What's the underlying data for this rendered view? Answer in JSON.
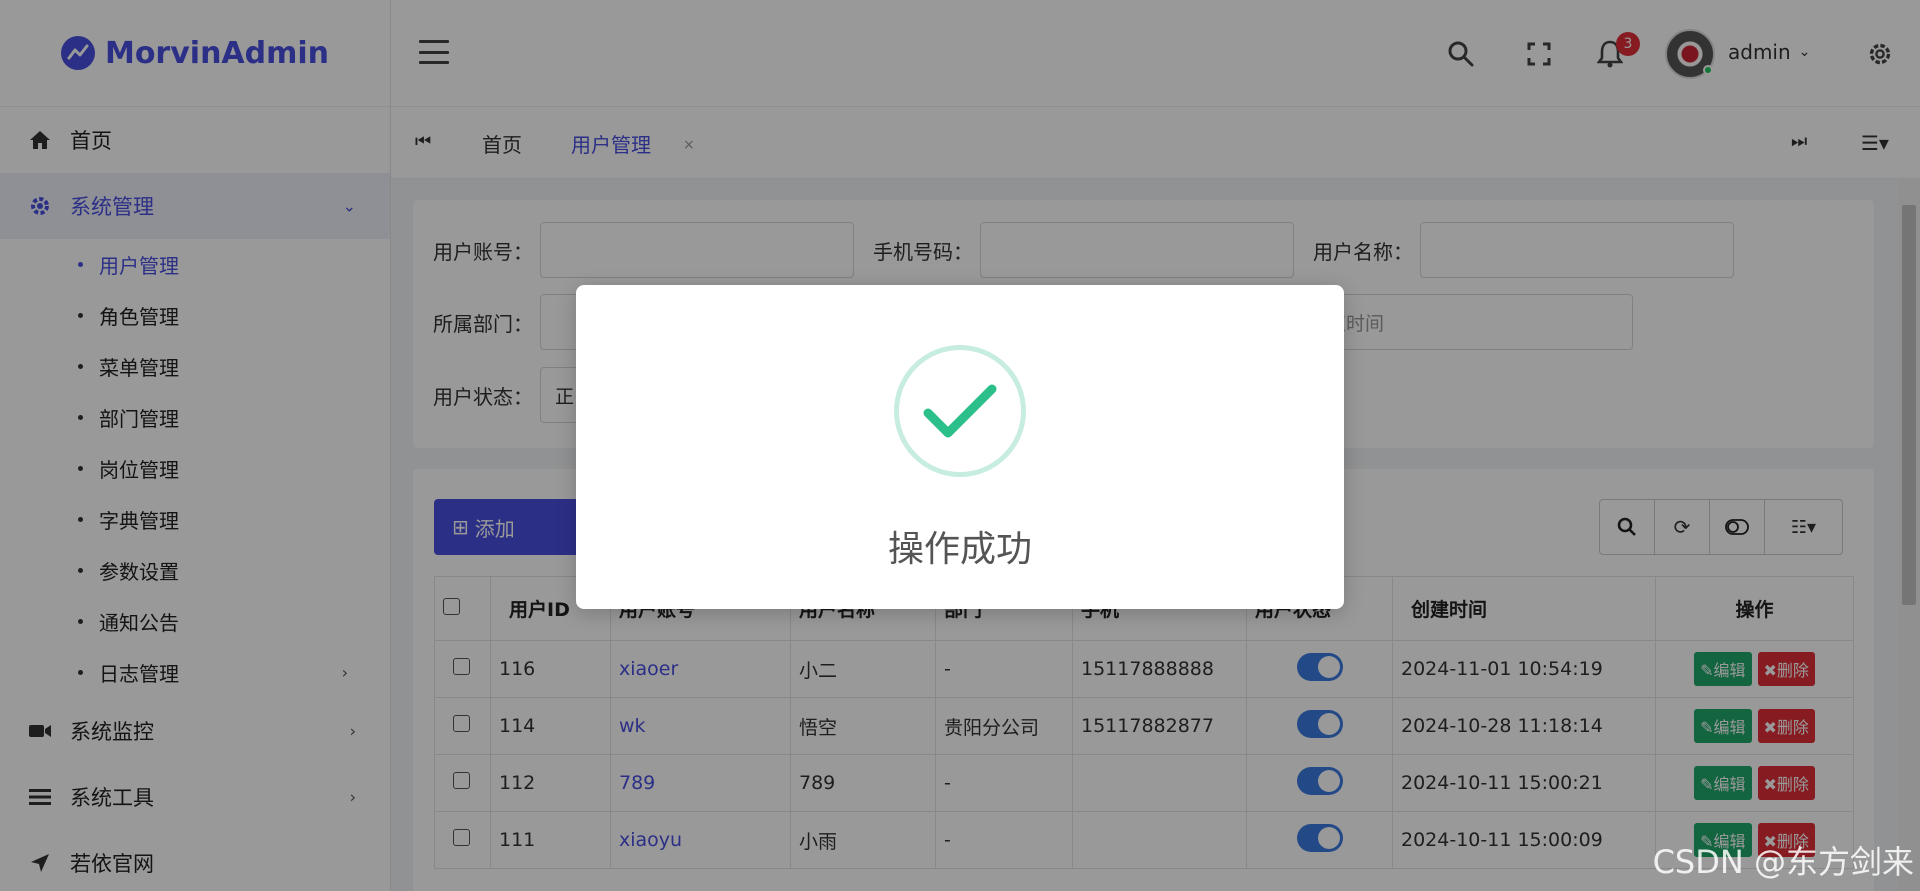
{
  "app": {
    "title": "MorvinAdmin"
  },
  "sidebar": {
    "items": [
      {
        "label": "首页",
        "icon": "home-icon"
      },
      {
        "label": "系统管理",
        "icon": "gear-icon",
        "expanded": true
      },
      {
        "label": "系统监控",
        "icon": "video-icon"
      },
      {
        "label": "系统工具",
        "icon": "list-icon"
      },
      {
        "label": "若依官网",
        "icon": "location-arrow-icon"
      }
    ],
    "sub_items": [
      {
        "label": "用户管理",
        "active": true
      },
      {
        "label": "角色管理"
      },
      {
        "label": "菜单管理"
      },
      {
        "label": "部门管理"
      },
      {
        "label": "岗位管理"
      },
      {
        "label": "字典管理"
      },
      {
        "label": "参数设置"
      },
      {
        "label": "通知公告"
      },
      {
        "label": "日志管理"
      }
    ]
  },
  "header": {
    "notification_count": "3",
    "user_name": "admin"
  },
  "tabs": {
    "items": [
      {
        "label": "首页"
      },
      {
        "label": "用户管理",
        "active": true
      }
    ],
    "close_label": "×"
  },
  "search": {
    "fields": [
      {
        "label": "用户账号：",
        "value": ""
      },
      {
        "label": "手机号码：",
        "value": ""
      },
      {
        "label": "用户名称：",
        "value": ""
      },
      {
        "label": "所属部门：",
        "value": ""
      },
      {
        "label": "用户状态：",
        "value": "正"
      }
    ],
    "end_time_placeholder": "结束时间"
  },
  "toolbar": {
    "add_label": "添加"
  },
  "table": {
    "headers": [
      "用户ID",
      "用户账号",
      "用户名称",
      "部门",
      "手机",
      "用户状态",
      "创建时间",
      "操作"
    ],
    "rows": [
      {
        "id": "116",
        "account": "xiaoer",
        "name": "小二",
        "dept": "-",
        "phone": "15117888888",
        "created": "2024-11-01 10:54:19"
      },
      {
        "id": "114",
        "account": "wk",
        "name": "悟空",
        "dept": "贵阳分公司",
        "phone": "15117882877",
        "created": "2024-10-28 11:18:14"
      },
      {
        "id": "112",
        "account": "789",
        "name": "789",
        "dept": "-",
        "phone": "",
        "created": "2024-10-11 15:00:21"
      },
      {
        "id": "111",
        "account": "xiaoyu",
        "name": "小雨",
        "dept": "-",
        "phone": "",
        "created": "2024-10-11 15:00:09"
      }
    ],
    "edit_label": "编辑",
    "delete_label": "删除"
  },
  "modal": {
    "message": "操作成功",
    "icon": "check-icon",
    "accent_color": "#2bbf8a"
  },
  "watermark": "CSDN @东方剑来",
  "colors": {
    "primary": "#4a4fe0",
    "success": "#1ea86a",
    "danger": "#e0303a",
    "toggle_on": "#3b7be0"
  }
}
